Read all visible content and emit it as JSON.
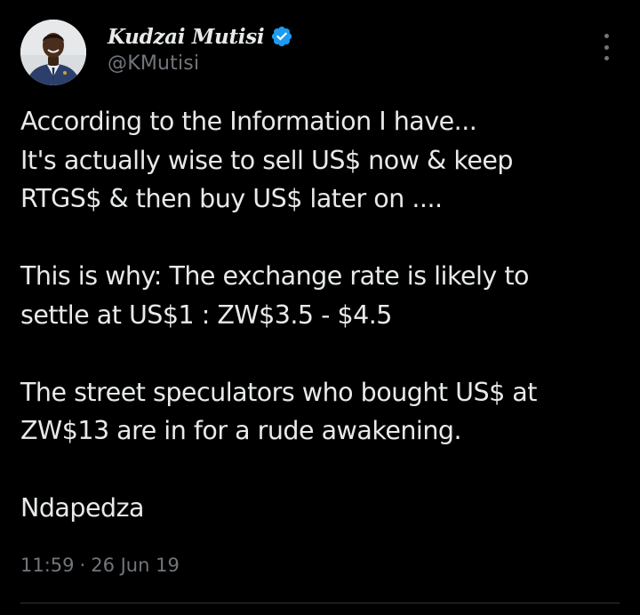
{
  "tweet": {
    "author": {
      "display_name": "Kudzai Mutisi",
      "handle": "@KMutisi",
      "verified": true,
      "verified_icon": "verified-badge-icon",
      "verified_color": "#1d9bf0"
    },
    "body": {
      "paragraph_1": [
        "According to the Information I have...",
        "It's actually wise to sell US$ now & keep",
        "RTGS$ & then buy US$ later on ...."
      ],
      "paragraph_2": [
        "This is why: The exchange rate is likely to",
        "settle at US$1 : ZW$3.5 - $4.5"
      ],
      "paragraph_3": [
        "The street speculators who bought US$ at",
        "ZW$13 are in for a rude awakening."
      ],
      "paragraph_4": [
        "Ndapedza"
      ]
    },
    "time": "11:59",
    "separator": "·",
    "date": "26 Jun 19",
    "more_icon": "more-options-icon"
  },
  "colors": {
    "background": "#000000",
    "text_primary": "#e7e9ea",
    "text_secondary": "#71767b",
    "divider": "#2f3336"
  }
}
